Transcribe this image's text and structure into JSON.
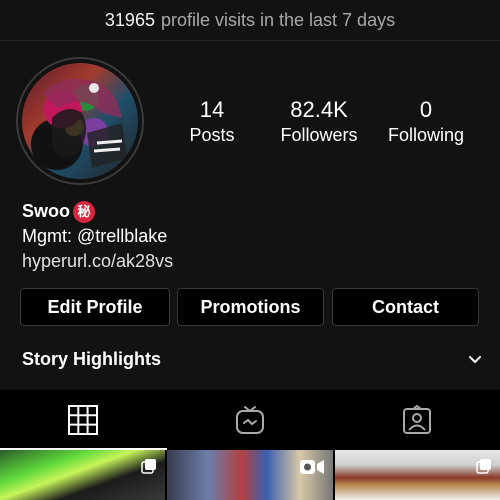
{
  "visits": {
    "count": "31965",
    "label": "profile visits in the last 7 days"
  },
  "stats": {
    "posts": {
      "value": "14",
      "label": "Posts"
    },
    "followers": {
      "value": "82.4K",
      "label": "Followers"
    },
    "following": {
      "value": "0",
      "label": "Following"
    }
  },
  "bio": {
    "name": "Swoo",
    "badge": "秘",
    "line1": "Mgmt: @trellblake",
    "link": "hyperurl.co/ak28vs"
  },
  "buttons": {
    "edit": "Edit Profile",
    "promotions": "Promotions",
    "contact": "Contact"
  },
  "highlights": {
    "label": "Story Highlights"
  },
  "tabs": [
    "grid-icon",
    "igtv-icon",
    "tagged-icon"
  ],
  "colors": {
    "background": "#121212",
    "badge": "#d7263d"
  }
}
